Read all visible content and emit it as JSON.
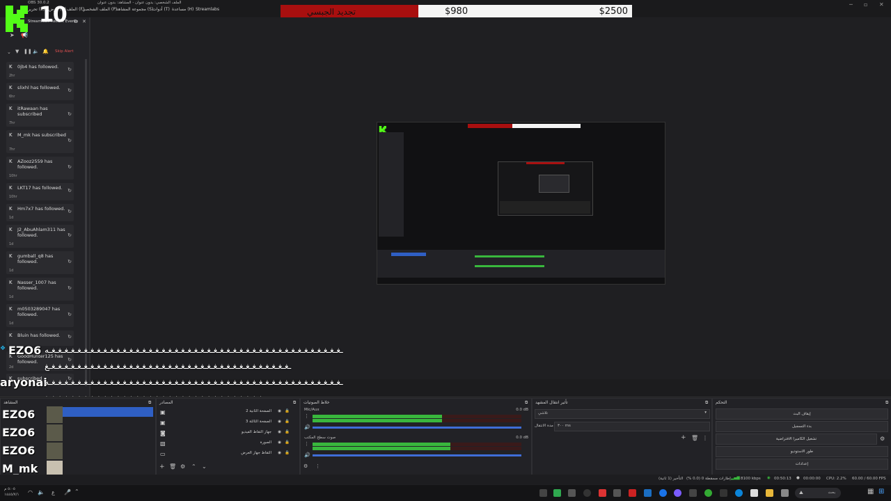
{
  "window": {
    "title": "الملف الشخصي: بدون عنوان - المشاهد: بدون عنوان",
    "app_version": "OBS 30.0.2"
  },
  "menu": {
    "items": [
      "الملف (F)",
      "تحرير (E)",
      "عرض (V)",
      "الملف الشخصي (P)",
      "مجموعة المشاهد (S)",
      "أدوات (T)",
      "مساعدة (H)",
      "Streamlabs"
    ]
  },
  "goal": {
    "label": "تجديد الجبسي",
    "current": "$980",
    "target": "$2500",
    "progress": 0.392,
    "fill_color": "#a80f0f"
  },
  "logo": {
    "number": "10",
    "color": "#53fc18"
  },
  "alerts": {
    "header": "Streamlabs Recent Events",
    "skip_label": "Skip Alert",
    "items": [
      {
        "text": "0jb4 has followed.",
        "time": "2hr"
      },
      {
        "text": "slixhl has followed.",
        "time": "6hr"
      },
      {
        "text": "itRawaan has subscribed",
        "time": "7hr"
      },
      {
        "text": "M_mk has subscribed",
        "time": "7hr"
      },
      {
        "text": "AZooz2559 has followed.",
        "time": "10hr"
      },
      {
        "text": "LKT17 has followed.",
        "time": "10hr"
      },
      {
        "text": "Hm7x7 has followed.",
        "time": "1d"
      },
      {
        "text": "J2_AbuAhlam311 has followed.",
        "time": "1d"
      },
      {
        "text": "gumball_q8 has followed.",
        "time": "1d"
      },
      {
        "text": "Nasser_1007 has followed.",
        "time": "1d"
      },
      {
        "text": "m0503289047 has followed.",
        "time": "1d"
      },
      {
        "text": "Bluin has followed.",
        "time": ""
      },
      {
        "text": "GoodHunter125 has followed.",
        "time": "2d"
      },
      {
        "text": "subscribed",
        "time": ""
      }
    ]
  },
  "chat": [
    {
      "name": "EZO6",
      "message": "ـغـغـغـغـغـغـغـغـغـغـغـغـغـغـغـغـغـغـغـغـغـغـغـغـغـغـغـغـغـغـغـغـغـغـغـغـغـغـغـغـغـغـغـغـغـه"
    },
    {
      "name": "",
      "message": "ـغـغـغـغـغـغـغـغـغـغـغـغـغـغـغـغـغـغـغـغـغـغـغـغـغـغـغـغـغـغـغـغـغـغـغـغـغـغ"
    },
    {
      "name": "aryonai",
      "message": "ـغـغـغـغـغـغـغـغـغـغـغـغـغـغـغـغـغـغـغـغـغـغـغـغـغـغـغـغـغـغـغـغـغـغـغـغـغـغـغـغـغـغـغـغـغـه"
    },
    {
      "name": "",
      "message": "ـغـغـغـغـغـغـغـغـغـغـغـغـغـغـغـغـغـغـغـغـغـغـغـغـغـغـغـغـغـغـغـغـغـغ"
    }
  ],
  "docks": {
    "scenes": {
      "title": "المشاهد",
      "items": [
        "EZO6",
        "EZO6",
        "EZO6",
        "M_mk"
      ]
    },
    "sources": {
      "title": "المصادر",
      "items": [
        "الصفحة الثانية 2",
        "الصفحة الثالثة 3",
        "جهاز التقاط الفيديو",
        "الصورة",
        "التقاط جهاز العرض"
      ]
    },
    "mixer": {
      "title": "خلاط الصوتيات",
      "tracks": [
        {
          "name": "Mic/Aux",
          "db": "0.0 dB",
          "level": 0.62
        },
        {
          "name": "صوت سطح المكتب",
          "db": "0.0 dB",
          "level": 0.66
        }
      ],
      "scale": [
        "-60",
        "-55",
        "-50",
        "-45",
        "-40",
        "-35",
        "-30",
        "-25",
        "-20",
        "-15",
        "-10",
        "-5",
        "0"
      ]
    },
    "transitions": {
      "title": "تأثير انتقال المشهد",
      "selected": "تلاشي",
      "duration_label": "مدة الانتقال",
      "duration_value": "٣٠٠ ms"
    },
    "controls": {
      "title": "التحكم",
      "buttons": [
        "إيقاف البث",
        "بدء التسجيل",
        "تشغيل الكاميرا الافتراضية",
        "طور الاستوديو",
        "إعدادات"
      ]
    }
  },
  "status": {
    "dropped": "إطارات مسقطة 0 (0.0 %)",
    "delay": "التأخير (1 ثانية)",
    "bitrate": "8100 kbps",
    "stream_time": "00:50:13",
    "rec_time": "00:00:00",
    "cpu": "CPU: 2.2%",
    "fps": "60.00 / 60.00 FPS"
  },
  "taskbar": {
    "clock_time": "٥:٠٥ م",
    "clock_date": "١٤٤٥/٧/١",
    "search_label": "بحث"
  }
}
